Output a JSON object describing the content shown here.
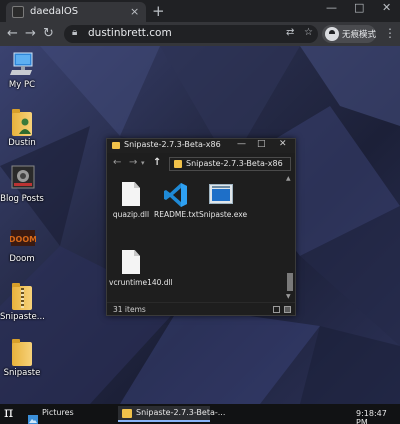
{
  "browser": {
    "tab_title": "daedalOS",
    "tab_close": "×",
    "new_tab": "+",
    "url": "dustinbrett.com",
    "profile_label": "无痕模式",
    "window_controls": [
      "—",
      "□",
      "✕"
    ]
  },
  "desktop": {
    "icons": [
      {
        "label": "My PC",
        "icon": "computer-icon"
      },
      {
        "label": "Dustin",
        "icon": "user-folder-icon"
      },
      {
        "label": "Blog Posts",
        "icon": "blog-icon"
      },
      {
        "label": "Doom",
        "icon": "doom-icon"
      },
      {
        "label": "Snipaste...",
        "icon": "zip-folder-icon"
      },
      {
        "label": "Snipaste",
        "icon": "folder-icon"
      }
    ]
  },
  "explorer": {
    "title": "Snipaste-2.7.3-Beta-x86",
    "address": "Snipaste-2.7.3-Beta-x86",
    "controls": [
      "—",
      "□",
      "✕"
    ],
    "files": [
      {
        "label": "quazip.dll",
        "icon": "dll-file-icon"
      },
      {
        "label": "README.txt",
        "icon": "vscode-file-icon"
      },
      {
        "label": "Snipaste.exe",
        "icon": "exe-file-icon"
      },
      {
        "label": "vcruntime140.dll",
        "icon": "dll-file-icon"
      }
    ],
    "status": "31 items"
  },
  "taskbar": {
    "start": "π",
    "tasks": [
      {
        "label": "Pictures",
        "icon": "pictures-icon"
      },
      {
        "label": "Snipaste-2.7.3-Beta-...",
        "icon": "folder-icon"
      }
    ],
    "clock": "9:18:47 PM"
  }
}
